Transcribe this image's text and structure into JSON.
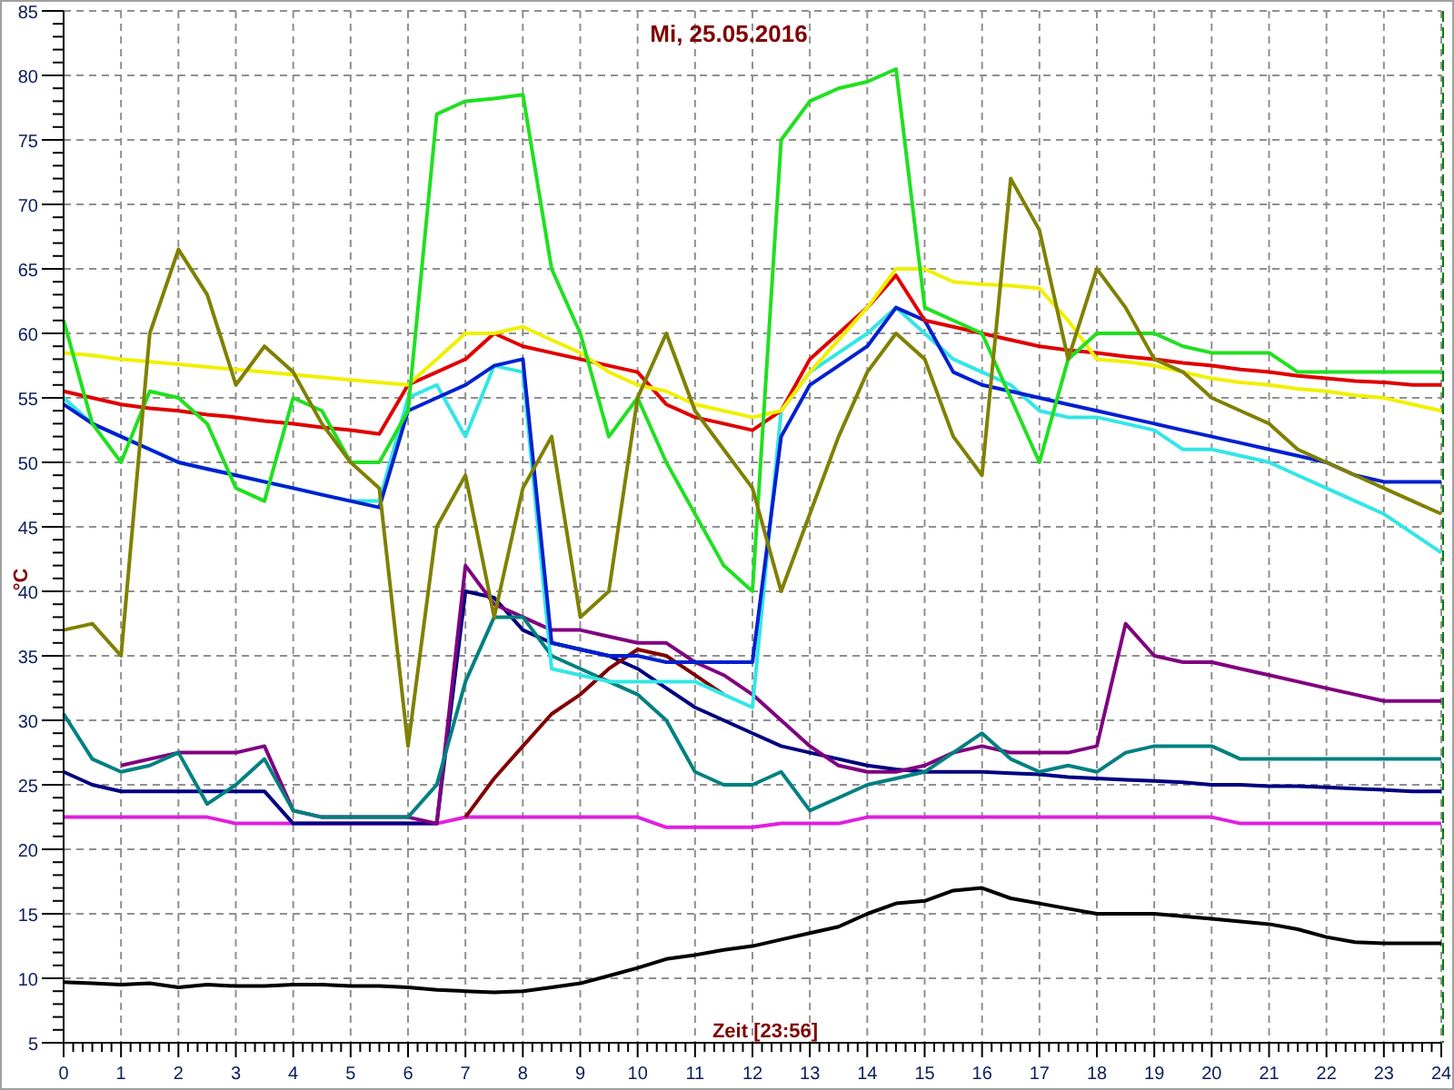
{
  "chart_data": {
    "type": "line",
    "title": "Mi, 25.05.2016",
    "xlabel": "Zeit [23:56]",
    "ylabel": "°C",
    "x": [
      0,
      0.5,
      1,
      1.5,
      2,
      2.5,
      3,
      3.5,
      4,
      4.5,
      5,
      5.5,
      6,
      6.5,
      7,
      7.5,
      8,
      8.5,
      9,
      9.5,
      10,
      10.5,
      11,
      11.5,
      12,
      12.5,
      13,
      13.5,
      14,
      14.5,
      15,
      15.5,
      16,
      16.5,
      17,
      17.5,
      18,
      18.5,
      19,
      19.5,
      20,
      20.5,
      21,
      21.5,
      22,
      22.5,
      23,
      23.5,
      24
    ],
    "xlim": [
      0,
      24
    ],
    "ylim": [
      5,
      85
    ],
    "grid": true,
    "xticks": [
      0,
      1,
      2,
      3,
      4,
      5,
      6,
      7,
      8,
      9,
      10,
      11,
      12,
      13,
      14,
      15,
      16,
      17,
      18,
      19,
      20,
      21,
      22,
      23,
      24
    ],
    "yticks": [
      5,
      10,
      15,
      20,
      25,
      30,
      35,
      40,
      45,
      50,
      55,
      60,
      65,
      70,
      75,
      80,
      85
    ],
    "series": [
      {
        "color": "#000000",
        "values": [
          9.7,
          9.6,
          9.5,
          9.6,
          9.3,
          9.5,
          9.4,
          9.4,
          9.5,
          9.5,
          9.4,
          9.4,
          9.3,
          9.1,
          9.0,
          8.9,
          9.0,
          9.3,
          9.6,
          10.2,
          10.8,
          11.5,
          11.8,
          12.2,
          12.5,
          13.0,
          13.5,
          14.0,
          15.0,
          15.8,
          16.0,
          16.8,
          17.0,
          16.2,
          15.8,
          15.4,
          15.0,
          15.0,
          15.0,
          14.8,
          14.6,
          14.4,
          14.2,
          13.8,
          13.2,
          12.8,
          12.7,
          12.7,
          12.7
        ]
      },
      {
        "color": "#e020e0",
        "values": [
          22.5,
          22.5,
          22.5,
          22.5,
          22.5,
          22.5,
          22,
          22,
          22,
          22,
          22,
          22,
          22,
          22,
          22.5,
          22.5,
          22.5,
          22.5,
          22.5,
          22.5,
          22.5,
          21.7,
          21.7,
          21.7,
          21.7,
          22,
          22,
          22,
          22.5,
          22.5,
          22.5,
          22.5,
          22.5,
          22.5,
          22.5,
          22.5,
          22.5,
          22.5,
          22.5,
          22.5,
          22.5,
          22,
          22,
          22,
          22,
          22,
          22,
          22,
          22
        ]
      },
      {
        "color": "#000080",
        "values": [
          26,
          25,
          24.5,
          24.5,
          24.5,
          24.5,
          24.5,
          24.5,
          22,
          22,
          22,
          22,
          22,
          22,
          40,
          39.5,
          37,
          36,
          35.5,
          35,
          34,
          32.5,
          31,
          30,
          29,
          28,
          27.5,
          27,
          26.5,
          26.2,
          26,
          26,
          26,
          25.9,
          25.8,
          25.6,
          25.5,
          25.4,
          25.3,
          25.2,
          25,
          25,
          24.9,
          24.9,
          24.8,
          24.7,
          24.6,
          24.5,
          24.5
        ]
      },
      {
        "color": "#800080",
        "values": [
          null,
          null,
          26.5,
          27,
          27.5,
          27.5,
          27.5,
          28,
          23,
          22.5,
          22.5,
          22.5,
          22.5,
          22,
          42,
          39,
          38,
          37,
          37,
          36.5,
          36,
          36,
          34.5,
          33.5,
          32,
          30,
          28,
          26.5,
          26,
          26,
          26.5,
          27.5,
          28,
          27.5,
          27.5,
          27.5,
          28,
          37.5,
          35,
          34.5,
          34.5,
          34,
          33.5,
          33,
          32.5,
          32,
          31.5,
          31.5,
          31.5
        ]
      },
      {
        "color": "#008080",
        "values": [
          30.5,
          27,
          26,
          26.5,
          27.5,
          23.5,
          25,
          27,
          23,
          22.5,
          22.5,
          22.5,
          22.5,
          25,
          33,
          38,
          38,
          35,
          34,
          33,
          32,
          30,
          26,
          25,
          25,
          26,
          23,
          24,
          25,
          25.5,
          26,
          27.5,
          29,
          27,
          26,
          26.5,
          26,
          27.5,
          28,
          28,
          28,
          27,
          27,
          27,
          27,
          27,
          27,
          27,
          27
        ]
      },
      {
        "color": "#800000",
        "values": [
          null,
          null,
          null,
          null,
          null,
          null,
          null,
          null,
          null,
          null,
          null,
          null,
          null,
          null,
          22.5,
          25.5,
          28,
          30.5,
          32,
          34,
          35.5,
          35,
          33.5,
          32,
          null,
          null,
          null,
          null,
          null,
          null,
          null,
          null,
          null,
          null,
          null,
          null,
          null,
          null,
          null,
          null,
          null,
          null,
          null,
          null,
          null,
          null,
          null,
          null,
          null
        ]
      },
      {
        "color": "#33e6e6",
        "values": [
          55,
          53,
          52,
          51,
          50,
          49.5,
          49,
          48.5,
          48,
          47.5,
          47,
          47,
          55,
          56,
          52,
          57.5,
          57,
          34,
          33.5,
          33,
          33,
          33,
          33,
          32,
          31,
          54,
          57,
          58.5,
          60,
          62,
          60,
          58,
          57,
          56,
          54,
          53.5,
          53.5,
          53,
          52.5,
          51,
          51,
          50.5,
          50,
          49,
          48,
          47,
          46,
          44.5,
          43
        ]
      },
      {
        "color": "#0020d0",
        "values": [
          54.5,
          53,
          52,
          51,
          50,
          49.5,
          49,
          48.5,
          48,
          47.5,
          47,
          46.5,
          54,
          55,
          56,
          57.5,
          58,
          36,
          35.5,
          35,
          35,
          34.5,
          34.5,
          34.5,
          34.5,
          52,
          56,
          57.5,
          59,
          62,
          61,
          57,
          56,
          55.5,
          55,
          54.5,
          54,
          53.5,
          53,
          52.5,
          52,
          51.5,
          51,
          50.5,
          50,
          49,
          48.5,
          48.5,
          48.5
        ]
      },
      {
        "color": "#e00000",
        "values": [
          55.5,
          55,
          54.5,
          54.2,
          54,
          53.7,
          53.5,
          53.2,
          53,
          52.7,
          52.5,
          52.2,
          56,
          57,
          58,
          60,
          59,
          58.5,
          58,
          57.5,
          57,
          54.5,
          53.5,
          53,
          52.5,
          54,
          58,
          60,
          62,
          64.5,
          61,
          60.5,
          60,
          59.5,
          59,
          58.7,
          58.5,
          58.2,
          58,
          57.7,
          57.5,
          57.2,
          57,
          56.7,
          56.5,
          56.3,
          56.2,
          56,
          56
        ]
      },
      {
        "color": "#f0f000",
        "values": [
          58.5,
          58.3,
          58,
          57.8,
          57.6,
          57.4,
          57.2,
          57,
          56.8,
          56.6,
          56.4,
          56.2,
          56,
          58,
          60,
          60,
          60.5,
          59.5,
          58.5,
          57,
          56,
          55.5,
          54.5,
          54,
          53.5,
          54,
          57,
          59.5,
          62,
          65,
          65,
          64,
          63.8,
          63.7,
          63.5,
          61,
          58,
          57.8,
          57.5,
          57,
          56.5,
          56.2,
          56,
          55.7,
          55.5,
          55.2,
          55,
          54.5,
          54
        ]
      },
      {
        "color": "#20e020",
        "values": [
          61,
          53,
          50,
          55.5,
          55,
          53,
          48,
          47,
          55,
          54,
          50,
          50,
          54,
          77,
          78,
          78.2,
          78.5,
          65,
          60,
          52,
          55,
          50,
          46,
          42,
          40,
          75,
          78,
          79,
          79.5,
          80.5,
          62,
          61,
          60,
          55,
          50,
          58,
          60,
          60,
          60,
          59,
          58.5,
          58.5,
          58.5,
          57,
          57,
          57,
          57,
          57,
          57
        ]
      },
      {
        "color": "#808000",
        "values": [
          37,
          37.5,
          35,
          60,
          66.5,
          63,
          56,
          59,
          57,
          53,
          50,
          48,
          28,
          45,
          49,
          38,
          48,
          52,
          38,
          40,
          55,
          60,
          54,
          51,
          48,
          40,
          46,
          52,
          57,
          60,
          58,
          52,
          49,
          72,
          68,
          58,
          65,
          62,
          58,
          57,
          55,
          54,
          53,
          51,
          50,
          49,
          48,
          47,
          46
        ]
      }
    ]
  }
}
